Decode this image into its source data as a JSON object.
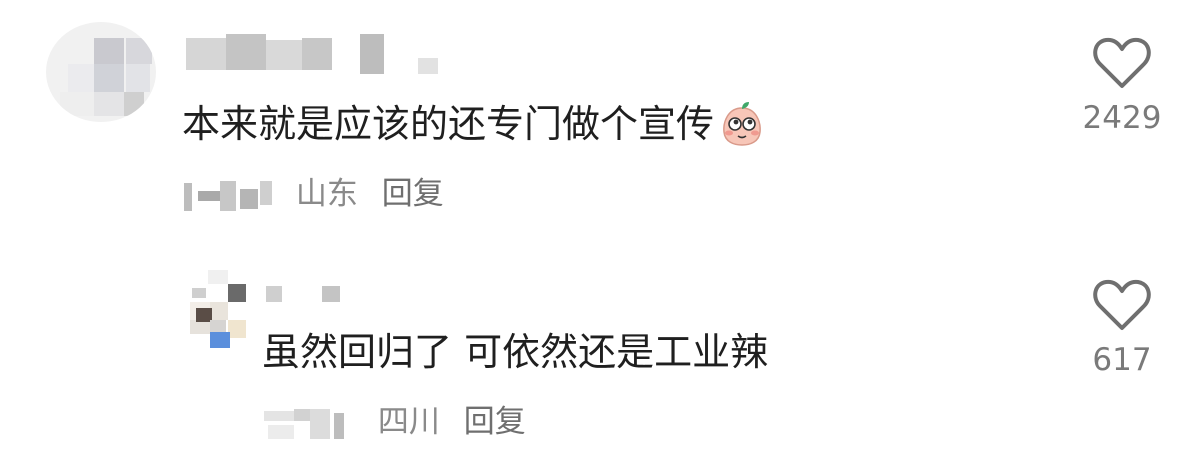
{
  "comments": [
    {
      "text": "本来就是应该的还专门做个宣传",
      "emoji": "blushing-peach-emoji",
      "location": "山东",
      "reply_label": "回复",
      "likes": "2429",
      "like_icon": "heart-outline-icon"
    },
    {
      "text": "虽然回归了 可依然还是工业辣",
      "location": "四川",
      "reply_label": "回复",
      "likes": "617",
      "like_icon": "heart-outline-icon"
    }
  ],
  "colors": {
    "text": "#1f1f1f",
    "meta": "#8a8a8a",
    "icon": "#6f6f6f",
    "emoji_face": "#f7c6b8",
    "emoji_leaf": "#3fa86a"
  }
}
